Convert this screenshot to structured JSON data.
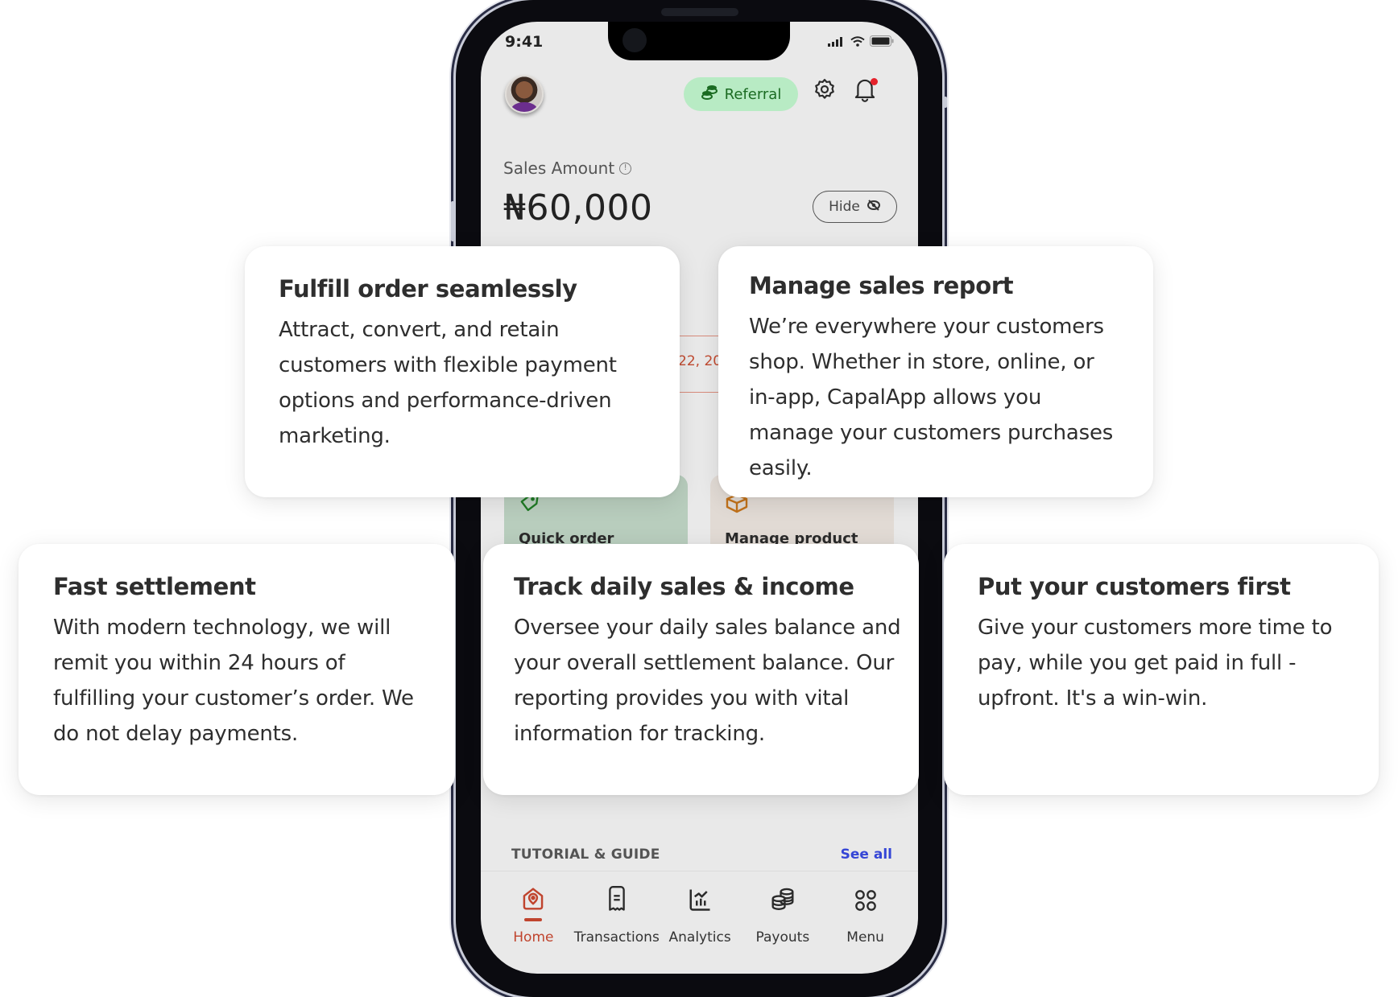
{
  "status_bar": {
    "time": "9:41"
  },
  "header": {
    "referral_label": "Referral",
    "icons": [
      "avatar",
      "coins-icon",
      "gear-icon",
      "bell-icon"
    ]
  },
  "balance": {
    "label": "Sales Amount",
    "amount": "₦60,000",
    "hide_label": "Hide"
  },
  "date_strip": {
    "partial_text": "22, 20"
  },
  "quick_actions": [
    {
      "label": "Quick order",
      "icon": "tag-icon",
      "color": "#1f7a25"
    },
    {
      "label": "Manage product",
      "icon": "box-icon",
      "color": "#c0711a"
    }
  ],
  "tutorial": {
    "title": "TUTORIAL & GUIDE",
    "see_all": "See all"
  },
  "bottom_nav": [
    {
      "label": "Home",
      "icon": "home-icon",
      "active": true
    },
    {
      "label": "Transactions",
      "icon": "receipt-icon",
      "active": false
    },
    {
      "label": "Analytics",
      "icon": "analytics-icon",
      "active": false
    },
    {
      "label": "Payouts",
      "icon": "coins-stack-icon",
      "active": false
    },
    {
      "label": "Menu",
      "icon": "grid-icon",
      "active": false
    }
  ],
  "features": [
    {
      "title": "Fulfill order seamlessly",
      "body": "Attract, convert, and retain customers with flexible payment options and performance-driven marketing."
    },
    {
      "title": "Manage sales report",
      "body": "We’re everywhere your customers shop. Whether in store, online, or in-app, CapalApp allows you manage your customers purchases easily."
    },
    {
      "title": "Fast settlement",
      "body": "With modern technology, we will remit you within 24 hours of fulfilling your customer’s order. We do not delay payments."
    },
    {
      "title": "Track daily sales & income",
      "body": "Oversee your daily sales balance and your overall settlement balance. Our reporting provides you with vital information for tracking."
    },
    {
      "title": "Put your customers first",
      "body": "Give your customers more time to pay, while you get paid in full - upfront. It's a win-win."
    }
  ],
  "colors": {
    "accent": "#c0442e",
    "referral_bg": "#b8ebc4",
    "referral_text": "#1b6b22",
    "link": "#3546d6",
    "notification_dot": "#e5222b"
  }
}
